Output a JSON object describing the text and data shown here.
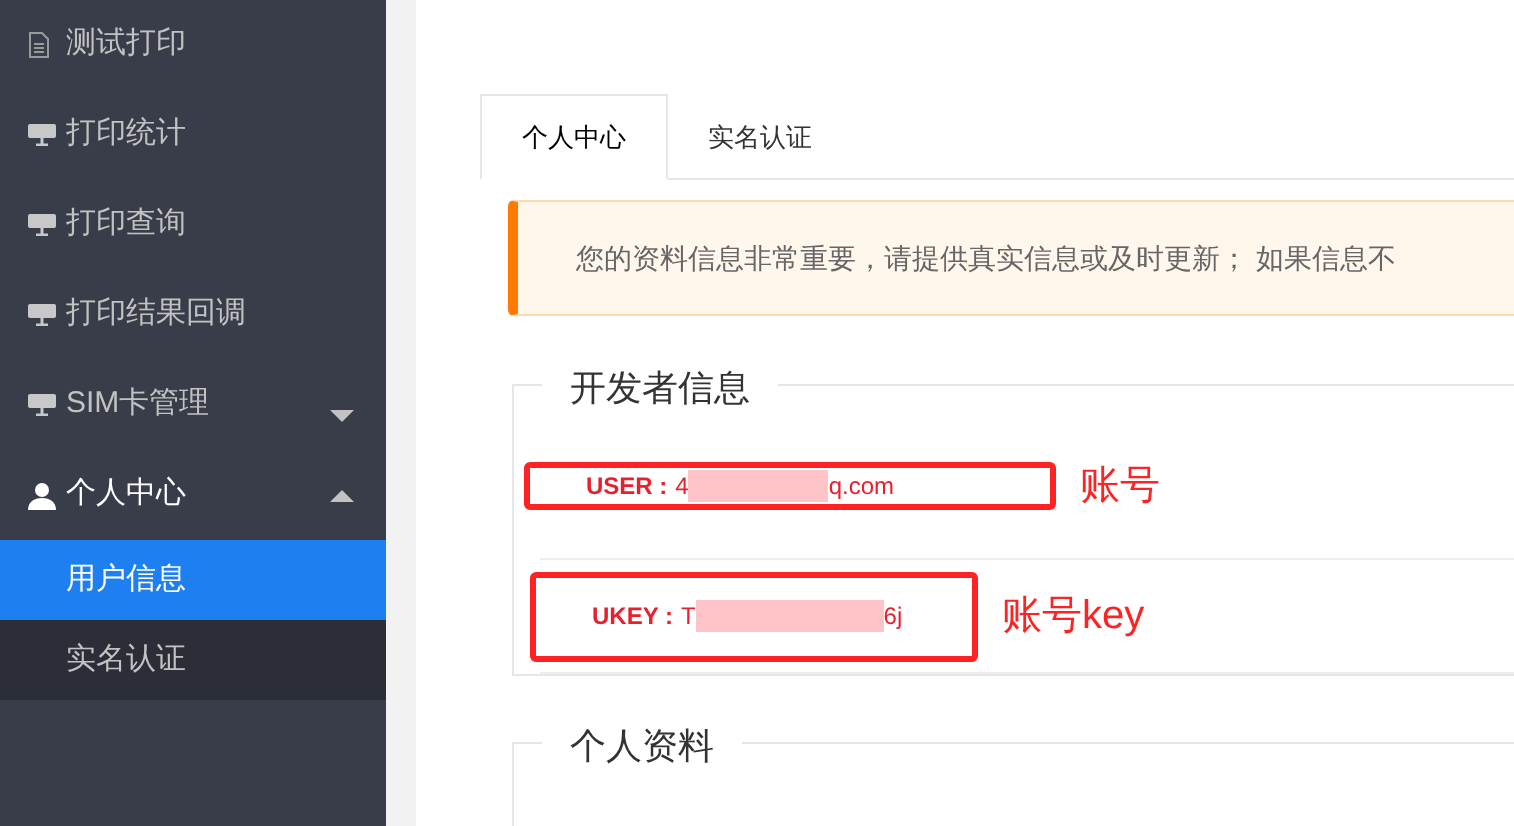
{
  "sidebar": {
    "items": [
      {
        "label": "测试打印",
        "kind": "document"
      },
      {
        "label": "打印统计",
        "kind": "monitor"
      },
      {
        "label": "打印查询",
        "kind": "monitor"
      },
      {
        "label": "打印结果回调",
        "kind": "monitor"
      },
      {
        "label": "SIM卡管理",
        "kind": "monitor",
        "expanded": false
      },
      {
        "label": "个人中心",
        "kind": "user",
        "expanded": true,
        "children": [
          {
            "label": "用户信息",
            "selected": true
          },
          {
            "label": "实名认证",
            "selected": false
          }
        ]
      }
    ]
  },
  "tabs": [
    {
      "label": "个人中心",
      "selected": true
    },
    {
      "label": "实名认证",
      "selected": false
    }
  ],
  "notice": "您的资料信息非常重要，请提供真实信息或及时更新； 如果信息不",
  "developer_info": {
    "title": "开发者信息",
    "fields": [
      {
        "label": "USER :",
        "value_start": "4",
        "value_end": "q.com",
        "annotation": "账号"
      },
      {
        "label": "UKEY :",
        "value_start": "T",
        "value_end": "6j",
        "annotation": "账号key"
      }
    ]
  },
  "personal_info": {
    "title": "个人资料"
  }
}
